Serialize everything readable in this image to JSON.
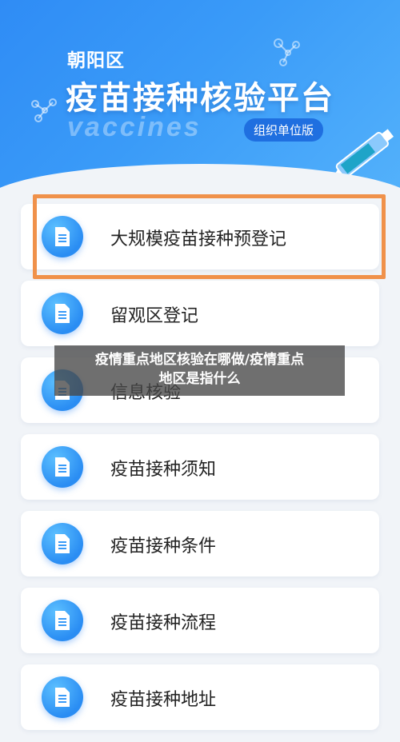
{
  "header": {
    "district": "朝阳区",
    "title": "疫苗接种核验平台",
    "wordmark": "vaccines",
    "org_badge": "组织单位版"
  },
  "menu": {
    "items": [
      {
        "label": "大规模疫苗接种预登记",
        "icon": "document-icon"
      },
      {
        "label": "留观区登记",
        "icon": "document-icon"
      },
      {
        "label": "信息核验",
        "icon": "document-icon"
      },
      {
        "label": "疫苗接种须知",
        "icon": "document-icon"
      },
      {
        "label": "疫苗接种条件",
        "icon": "document-icon"
      },
      {
        "label": "疫苗接种流程",
        "icon": "document-icon"
      },
      {
        "label": "疫苗接种地址",
        "icon": "document-icon"
      }
    ]
  },
  "overlay": {
    "line1": "疫情重点地区核验在哪做/疫情重点",
    "line2": "地区是指什么"
  },
  "colors": {
    "header_blue": "#2f8cf5",
    "badge_blue": "#1f6fe0",
    "highlight_orange": "#f0914a",
    "icon_blue": "#2a8df3"
  }
}
